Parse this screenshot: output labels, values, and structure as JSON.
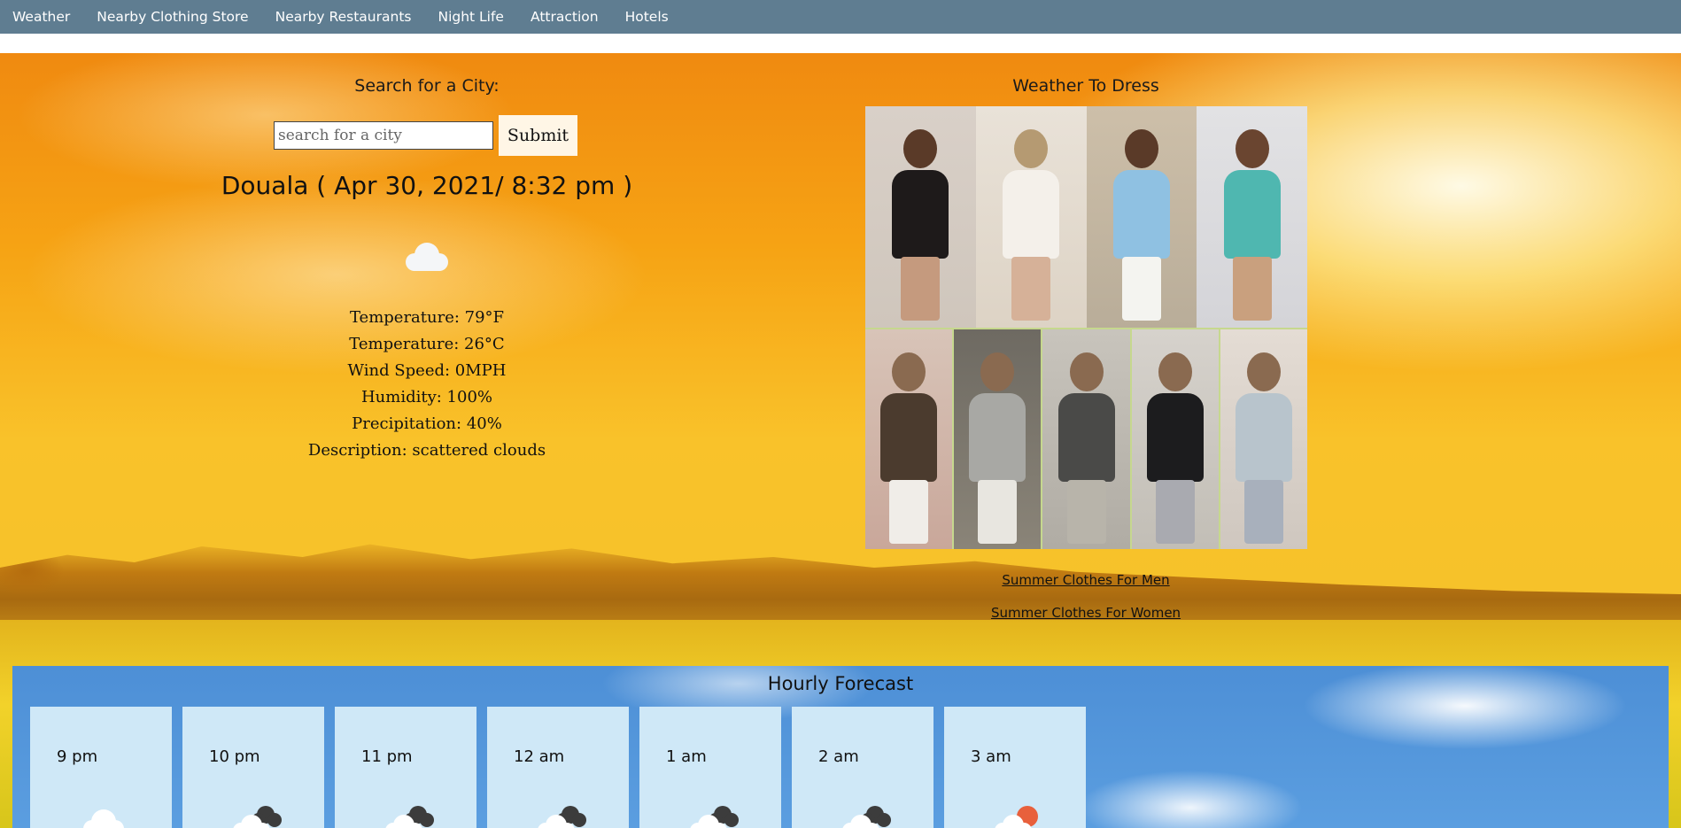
{
  "nav": {
    "items": [
      "Weather",
      "Nearby Clothing Store",
      "Nearby Restaurants",
      "Night Life",
      "Attraction",
      "Hotels"
    ]
  },
  "search": {
    "title": "Search for a City:",
    "placeholder": "search for a city",
    "submit_label": "Submit"
  },
  "current": {
    "city_title": "Douala ( Apr 30, 2021/ 8:32 pm )",
    "icon": "cloud-icon",
    "temperature_f": "Temperature: 79°F",
    "temperature_c": "Temperature: 26°C",
    "wind": "Wind Speed: 0MPH",
    "humidity": "Humidity: 100%",
    "precipitation": "Precipitation: 40%",
    "description": "Description: scattered clouds"
  },
  "dress": {
    "title": "Weather To Dress",
    "link_men": "Summer Clothes For Men",
    "link_women": "Summer Clothes For Women"
  },
  "hourly": {
    "title": "Hourly Forecast",
    "items": [
      {
        "time": "9 pm",
        "icon": "cloud-icon"
      },
      {
        "time": "10 pm",
        "icon": "cloud-dark-cloud-icon"
      },
      {
        "time": "11 pm",
        "icon": "cloud-dark-cloud-icon"
      },
      {
        "time": "12 am",
        "icon": "cloud-dark-cloud-icon"
      },
      {
        "time": "1 am",
        "icon": "cloud-dark-cloud-icon"
      },
      {
        "time": "2 am",
        "icon": "cloud-dark-cloud-icon"
      },
      {
        "time": "3 am",
        "icon": "sun-cloud-icon"
      }
    ]
  },
  "colors": {
    "nav_bg": "#5f7d91",
    "hourly_card_bg": "#cfe8f7",
    "hourly_bg": "#4d8fd6"
  }
}
